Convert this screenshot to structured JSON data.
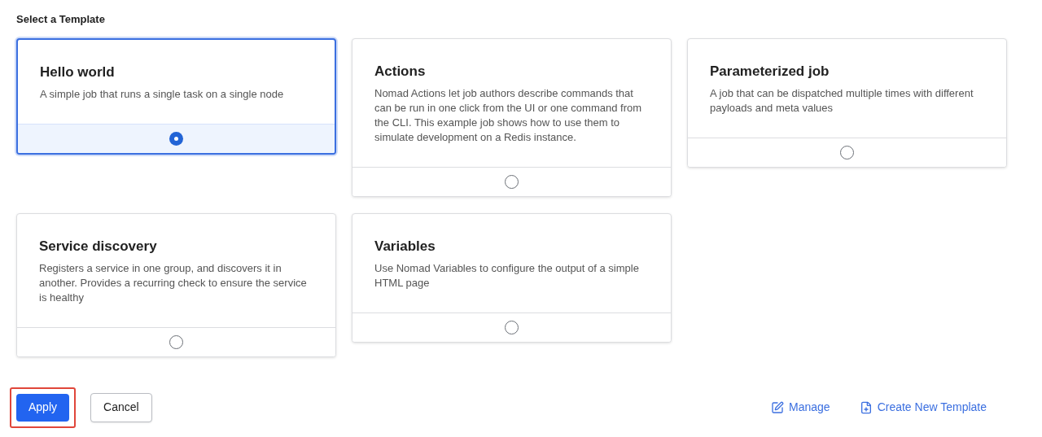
{
  "heading": "Select a Template",
  "templates": [
    {
      "title": "Hello world",
      "description": "A simple job that runs a single task on a single node",
      "selected": true
    },
    {
      "title": "Actions",
      "description": "Nomad Actions let job authors describe commands that can be run in one click from the UI or one command from the CLI. This example job shows how to use them to simulate development on a Redis instance.",
      "selected": false
    },
    {
      "title": "Parameterized job",
      "description": "A job that can be dispatched multiple times with different payloads and meta values",
      "selected": false
    },
    {
      "title": "Service discovery",
      "description": "Registers a service in one group, and discovers it in another. Provides a recurring check to ensure the service is healthy",
      "selected": false
    },
    {
      "title": "Variables",
      "description": "Use Nomad Variables to configure the output of a simple HTML page",
      "selected": false
    }
  ],
  "buttons": [
    {
      "label": "Apply",
      "kind": "primary",
      "highlighted": true
    },
    {
      "label": "Cancel",
      "kind": "secondary",
      "highlighted": false
    }
  ],
  "links": [
    {
      "label": "Manage",
      "kind": "edit"
    },
    {
      "label": "Create New Template",
      "kind": "new"
    }
  ]
}
